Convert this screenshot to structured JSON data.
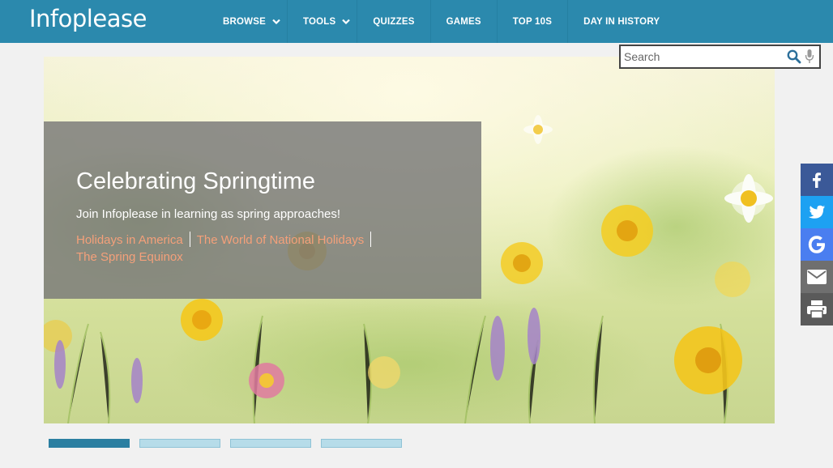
{
  "header": {
    "logo": "Infoplease",
    "nav": [
      {
        "label": "BROWSE",
        "dropdown": true
      },
      {
        "label": "TOOLS",
        "dropdown": true
      },
      {
        "label": "QUIZZES",
        "dropdown": false
      },
      {
        "label": "GAMES",
        "dropdown": false
      },
      {
        "label": "TOP 10S",
        "dropdown": false
      },
      {
        "label": "DAY IN HISTORY",
        "dropdown": false
      }
    ]
  },
  "search": {
    "placeholder": "Search",
    "value": ""
  },
  "hero": {
    "title": "Celebrating Springtime",
    "subtitle": "Join Infoplease in learning as spring approaches!",
    "links": [
      "Holidays in America",
      "The World of National Holidays",
      "The Spring Equinox"
    ]
  },
  "social": [
    {
      "icon": "facebook-icon",
      "color": "#3b5998"
    },
    {
      "icon": "twitter-icon",
      "color": "#1da1f2"
    },
    {
      "icon": "google-icon",
      "color": "#4a7ef0"
    },
    {
      "icon": "email-icon",
      "color": "#6f6f6f"
    },
    {
      "icon": "print-icon",
      "color": "#5a5a5a"
    }
  ],
  "carousel": {
    "slide_count": 4,
    "active_index": 0
  },
  "colors": {
    "brand": "#2b89ad",
    "link": "#f4a07a",
    "indicator_active": "#2b7fa1",
    "indicator_inactive": "#b6dce9"
  }
}
